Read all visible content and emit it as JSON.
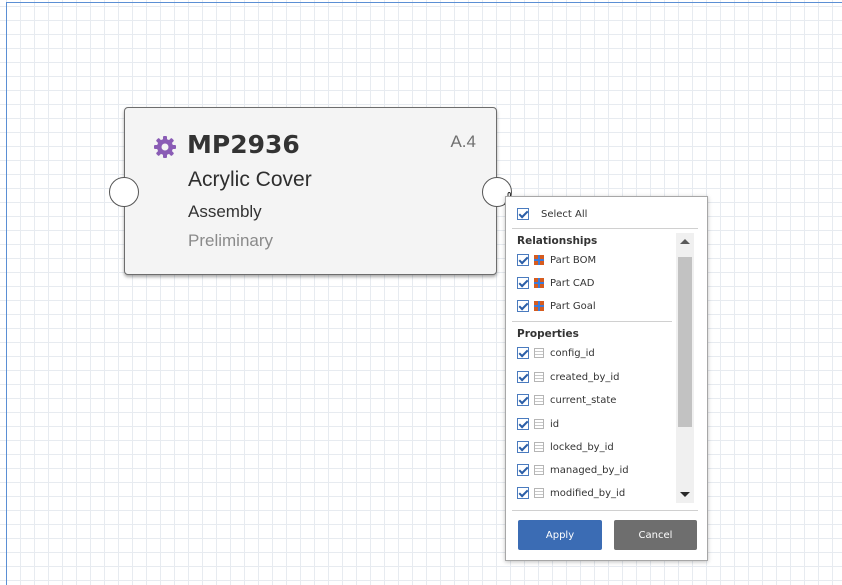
{
  "node": {
    "id": "MP2936",
    "revision": "A.4",
    "name": "Acrylic Cover",
    "type": "Assembly",
    "state": "Preliminary",
    "icon": "gear-icon",
    "icon_color": "#8a5cb5"
  },
  "filter_panel": {
    "select_all_label": "Select All",
    "relationships_heading": "Relationships",
    "relationships": [
      {
        "label": "Part BOM",
        "checked": true
      },
      {
        "label": "Part CAD",
        "checked": true
      },
      {
        "label": "Part Goal",
        "checked": true
      }
    ],
    "properties_heading": "Properties",
    "properties": [
      {
        "label": "config_id",
        "checked": true
      },
      {
        "label": "created_by_id",
        "checked": true
      },
      {
        "label": "current_state",
        "checked": true
      },
      {
        "label": "id",
        "checked": true
      },
      {
        "label": "locked_by_id",
        "checked": true
      },
      {
        "label": "managed_by_id",
        "checked": true
      },
      {
        "label": "modified_by_id",
        "checked": true
      }
    ],
    "apply_label": "Apply",
    "cancel_label": "Cancel"
  },
  "colors": {
    "apply": "#3b6cb4",
    "cancel": "#6e6e6e",
    "grid": "#e7ebf0",
    "accent_border": "#5b8fd4"
  }
}
